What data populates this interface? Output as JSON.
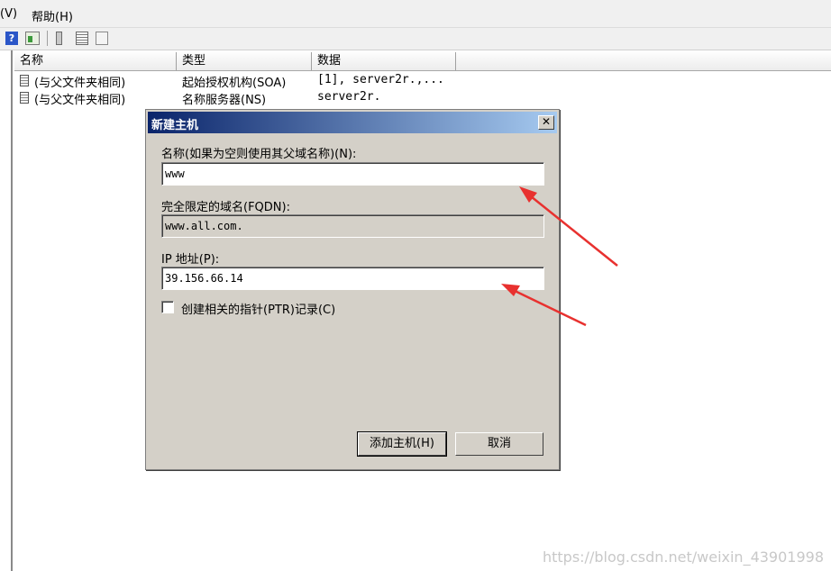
{
  "menubar": {
    "view_label": "(V)",
    "help_label": "帮助(H)"
  },
  "toolbar": {
    "icons": [
      "help-icon",
      "window-icon",
      "server-icon",
      "list-icon",
      "copy-icon"
    ]
  },
  "list": {
    "columns": [
      "名称",
      "类型",
      "数据"
    ],
    "rows": [
      {
        "name": "(与父文件夹相同)",
        "type": "起始授权机构(SOA)",
        "data": "[1], server2r.,..."
      },
      {
        "name": "(与父文件夹相同)",
        "type": "名称服务器(NS)",
        "data": "server2r."
      }
    ]
  },
  "dialog": {
    "title": "新建主机",
    "close_label": "✕",
    "name_label": "名称(如果为空则使用其父域名称)(N):",
    "name_value": "www",
    "fqdn_label": "完全限定的域名(FQDN):",
    "fqdn_value": "www.all.com.",
    "ip_label": "IP 地址(P):",
    "ip_value": "39.156.66.14",
    "ptr_label": "创建相关的指针(PTR)记录(C)",
    "ptr_checked": false,
    "add_button": "添加主机(H)",
    "cancel_button": "取消"
  },
  "annotation_color": "#e8312f",
  "watermark": "https://blog.csdn.net/weixin_43901998"
}
